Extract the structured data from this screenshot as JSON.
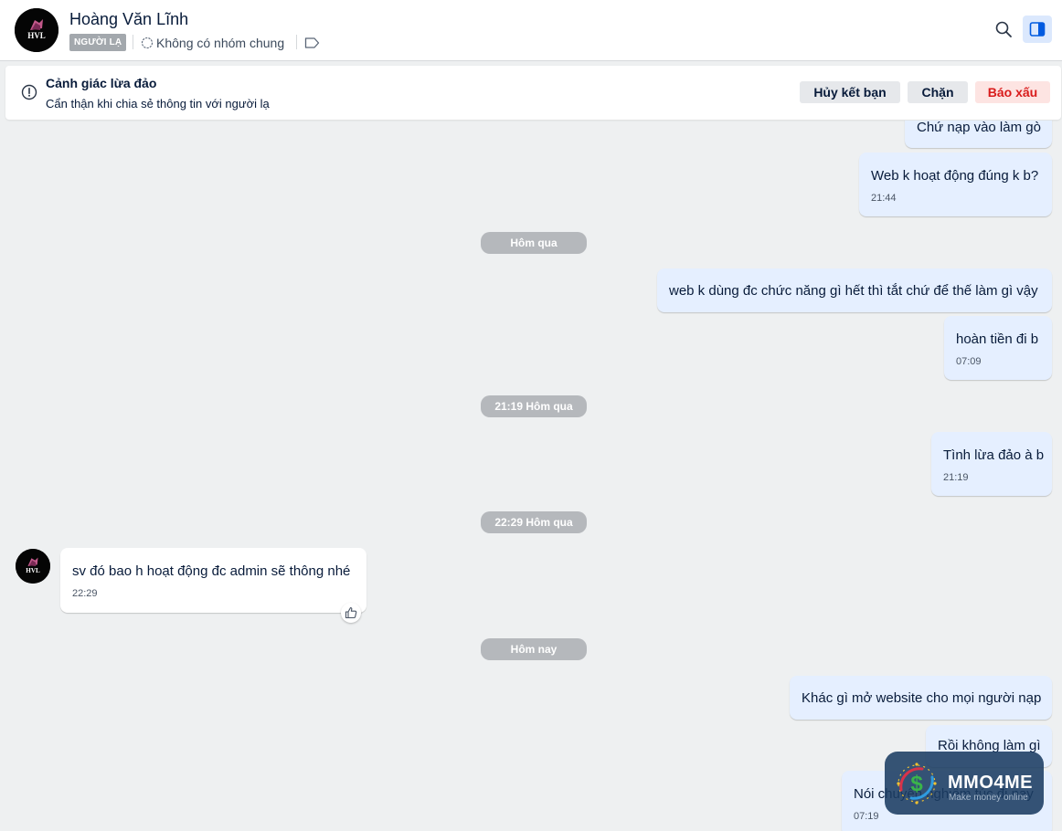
{
  "header": {
    "contact_name": "Hoàng Văn Lĩnh",
    "badge": "NGƯỜI LẠ",
    "mutual_groups": "Không có nhóm chung",
    "avatar_initials": "HVL"
  },
  "banner": {
    "title": "Cảnh giác lừa đảo",
    "subtitle": "Cẩn thận khi chia sẻ thông tin với người lạ",
    "unfriend_label": "Hủy kết bạn",
    "block_label": "Chặn",
    "report_label": "Báo xấu"
  },
  "messages": {
    "m0": {
      "text": "Chứ nạp vào làm gò"
    },
    "m1": {
      "text": "Web k hoạt động đúng k b?",
      "time": "21:44"
    },
    "d1": "Hôm qua",
    "m2": {
      "text": "web k dùng đc chức năng gì hết thì tắt chứ để thế làm gì vậy"
    },
    "m3": {
      "text": "hoàn tiền đi b",
      "time": "07:09"
    },
    "d2": "21:19 Hôm qua",
    "m4": {
      "text": "Tình lừa đảo à b",
      "time": "21:19"
    },
    "d3": "22:29 Hôm qua",
    "m5": {
      "text": "sv đó bao h hoạt động đc admin sẽ thông nhé",
      "time": "22:29"
    },
    "d4": "Hôm nay",
    "m6": {
      "text": "Khác gì mở website cho mọi người nạp"
    },
    "m7": {
      "text": "Rồi không làm gì"
    },
    "m8": {
      "text": "Nói chuyện nghiêm túc đi nay",
      "time": "07:19"
    }
  },
  "watermark": {
    "name": "MMO4ME",
    "tagline": "Make money online"
  },
  "colors": {
    "outgoing_bubble": "#e5efff",
    "incoming_bubble": "#ffffff",
    "report_text": "#d91b1b",
    "accent": "#005ae0"
  }
}
